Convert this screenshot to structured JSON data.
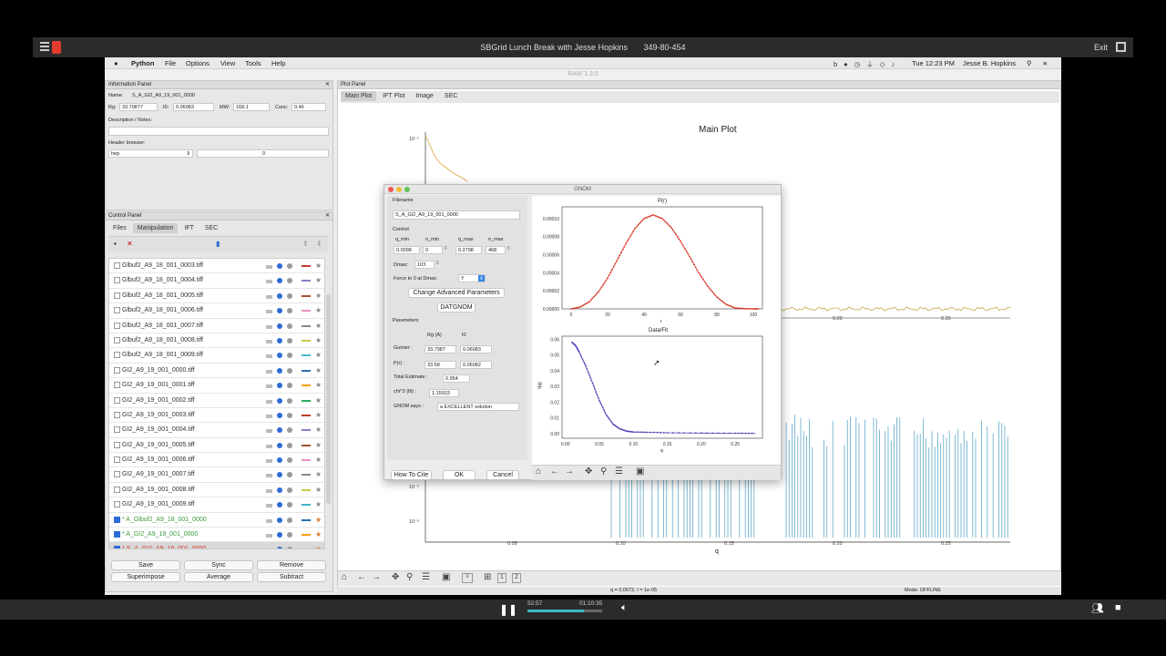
{
  "player": {
    "title": "SBGrid Lunch Break with Jesse Hopkins",
    "meeting_id": "349-80-454",
    "exit": "Exit",
    "time_elapsed": "52:57",
    "time_total": "01:10:35",
    "progress": 0.75
  },
  "menubar": {
    "app": "Python",
    "items": [
      "File",
      "Options",
      "View",
      "Tools",
      "Help"
    ],
    "clock": "Tue 12:23 PM",
    "user": "Jesse B. Hopkins"
  },
  "window_title": "RAW 1.3.0",
  "info_panel": {
    "header": "Information Panel",
    "name_label": "Name:",
    "name_value": "S_A_GI2_A9_19_001_0000",
    "rg_label": "Rg:",
    "rg_value": "33.79877",
    "i0_label": "I0:",
    "i0_value": "0.06083",
    "mw_label": "MW:",
    "mw_value": "168.1",
    "conc_label": "Conc:",
    "conc_value": "0.46",
    "notes_label": "Description / Notes:",
    "header_browser_label": "Header browser:",
    "header_select": "hep",
    "header_value": "0"
  },
  "control_panel": {
    "header": "Control Panel",
    "tabs": [
      "Files",
      "Manipulation",
      "IFT",
      "SEC"
    ],
    "active_tab": "Manipulation",
    "files": [
      {
        "name": "Glbuf2_A9_18_001_0003.tiff",
        "checked": false,
        "color": "#c0392b"
      },
      {
        "name": "Glbuf2_A9_18_001_0004.tiff",
        "checked": false,
        "color": "#8e7cc3"
      },
      {
        "name": "Glbuf2_A9_18_001_0005.tiff",
        "checked": false,
        "color": "#a0522d"
      },
      {
        "name": "Glbuf2_A9_18_001_0006.tiff",
        "checked": false,
        "color": "#e88fc0"
      },
      {
        "name": "Glbuf2_A9_18_001_0007.tiff",
        "checked": false,
        "color": "#888888"
      },
      {
        "name": "Glbuf2_A9_18_001_0008.tiff",
        "checked": false,
        "color": "#c8c84a"
      },
      {
        "name": "Glbuf2_A9_18_001_0009.tiff",
        "checked": false,
        "color": "#40b8c8"
      },
      {
        "name": "GI2_A9_19_001_0000.tiff",
        "checked": false,
        "color": "#2a6fb0"
      },
      {
        "name": "GI2_A9_19_001_0001.tiff",
        "checked": false,
        "color": "#f39c12"
      },
      {
        "name": "GI2_A9_19_001_0002.tiff",
        "checked": false,
        "color": "#27ae60"
      },
      {
        "name": "GI2_A9_19_001_0003.tiff",
        "checked": false,
        "color": "#c0392b"
      },
      {
        "name": "GI2_A9_19_001_0004.tiff",
        "checked": false,
        "color": "#8e7cc3"
      },
      {
        "name": "GI2_A9_19_001_0005.tiff",
        "checked": false,
        "color": "#a0522d"
      },
      {
        "name": "GI2_A9_19_001_0006.tiff",
        "checked": false,
        "color": "#e88fc0"
      },
      {
        "name": "GI2_A9_19_001_0007.tiff",
        "checked": false,
        "color": "#888888"
      },
      {
        "name": "GI2_A9_19_001_0008.tiff",
        "checked": false,
        "color": "#c8c84a"
      },
      {
        "name": "GI2_A9_19_001_0009.tiff",
        "checked": false,
        "color": "#40b8c8"
      },
      {
        "name": "* A_Glbuf2_A9_18_001_0000",
        "checked": true,
        "color": "#2a6fb0",
        "text_color": "#3a9a3a"
      },
      {
        "name": "* A_GI2_A9_19_001_0000",
        "checked": true,
        "color": "#f39c12",
        "text_color": "#3a9a3a"
      },
      {
        "name": "* S_A_GI2_A9_19_001_0000",
        "checked": true,
        "color": "#2a6fb0",
        "text_color": "#d63a2a",
        "selected": true
      }
    ],
    "buttons": [
      "Save",
      "Sync",
      "Remove",
      "Superimpose",
      "Average",
      "Subtract"
    ]
  },
  "plot_panel": {
    "header": "Plot Panel",
    "tabs": [
      "Main Plot",
      "IFT Plot",
      "Image",
      "SEC"
    ],
    "active_tab": "Main Plot",
    "title": "Main Plot",
    "xlabel": "q",
    "y_tick_top": "10⁻¹",
    "y_ticks_bottom": [
      "10⁻⁵",
      "10⁻⁶"
    ],
    "x_ticks_upper": [
      "0.20",
      "0.25"
    ],
    "x_ticks_lower": [
      "0.05",
      "0.10",
      "0.15",
      "0.20",
      "0.25"
    ],
    "status": "q = 0.0672, I = 1e-05",
    "mode": "Mode: OFFLINE",
    "toolbar_pages": [
      "1",
      "2"
    ]
  },
  "gnom": {
    "title": "GNOM",
    "filename_label": "Filename",
    "filename": "S_A_GI2_A9_19_001_0000",
    "control_label": "Control",
    "qmin_label": "q_min",
    "nmin_label": "n_min",
    "qmax_label": "q_max",
    "nmax_label": "n_max",
    "qmin": "0.0098",
    "nmin": "0",
    "qmax": "0.2798",
    "nmax": "468",
    "dmax_label": "Dmax:",
    "dmax": "103",
    "force_label": "Force to 0 at Dmax:",
    "force_value": "Y",
    "adv_button": "Change Advanced Parameters",
    "datgnom_button": "DATGNOM",
    "params_label": "Parameters",
    "rg_col": "Rg (A)",
    "i0_col": "I0",
    "guinier_label": "Guinier :",
    "guinier_rg": "33.7987",
    "guinier_i0": "0.06083",
    "pr_label": "P(r) :",
    "pr_rg": "33.58",
    "pr_i0": "0.06082",
    "te_label": "Total Estimate :",
    "te_value": "0.954",
    "chi_label": "chi^2 (fit) :",
    "chi_value": "1.15933",
    "says_label": "GNOM says :",
    "says_value": "a EXCELLENT solution",
    "cite_button": "How To Cite",
    "ok_button": "OK",
    "cancel_button": "Cancel",
    "pr_title": "P(r)",
    "pr_xlabel": "r",
    "pr_yticks": [
      "0.00010",
      "0.00008",
      "0.00006",
      "0.00004",
      "0.00002",
      "0.00000"
    ],
    "pr_xticks": [
      "0",
      "20",
      "40",
      "60",
      "80",
      "100"
    ],
    "fit_title": "Data/Fit",
    "fit_xlabel": "q",
    "fit_ylabel": "I(q)",
    "fit_yticks": [
      "0.06",
      "0.05",
      "0.04",
      "0.03",
      "0.02",
      "0.01",
      "0.00"
    ],
    "fit_xticks": [
      "0.00",
      "0.05",
      "0.10",
      "0.15",
      "0.20",
      "0.25"
    ]
  },
  "chart_data": [
    {
      "type": "line",
      "title": "P(r)",
      "xlabel": "r",
      "xlim": [
        -5,
        105
      ],
      "ylim": [
        0,
        0.000113
      ],
      "x": [
        0,
        5,
        10,
        15,
        20,
        25,
        30,
        35,
        40,
        45,
        50,
        55,
        60,
        65,
        70,
        75,
        80,
        85,
        90,
        95,
        100,
        103
      ],
      "series": [
        {
          "color": "#d93a2b",
          "values": [
            0,
            2e-06,
            8e-06,
            1.9e-05,
            3.4e-05,
            5.3e-05,
            7.2e-05,
            8.9e-05,
            0.0001,
            0.000104,
            0.0001,
            9e-05,
            7.5e-05,
            5.8e-05,
            4e-05,
            2.5e-05,
            1.3e-05,
            5e-06,
            1e-06,
            2e-07,
            0,
            0
          ]
        }
      ]
    },
    {
      "type": "line",
      "title": "Data/Fit",
      "xlabel": "q",
      "ylabel": "I(q)",
      "xlim": [
        -0.005,
        0.29
      ],
      "ylim": [
        -0.003,
        0.062
      ],
      "x": [
        0.0098,
        0.015,
        0.02,
        0.03,
        0.04,
        0.05,
        0.06,
        0.07,
        0.08,
        0.09,
        0.1,
        0.12,
        0.15,
        0.2,
        0.25,
        0.2798
      ],
      "series": [
        {
          "color": "#5b3fb8",
          "values": [
            0.058,
            0.056,
            0.052,
            0.043,
            0.032,
            0.021,
            0.012,
            0.006,
            0.003,
            0.0015,
            0.001,
            0.0008,
            0.0005,
            0.0003,
            0.0002,
            0.0001
          ]
        }
      ]
    }
  ]
}
